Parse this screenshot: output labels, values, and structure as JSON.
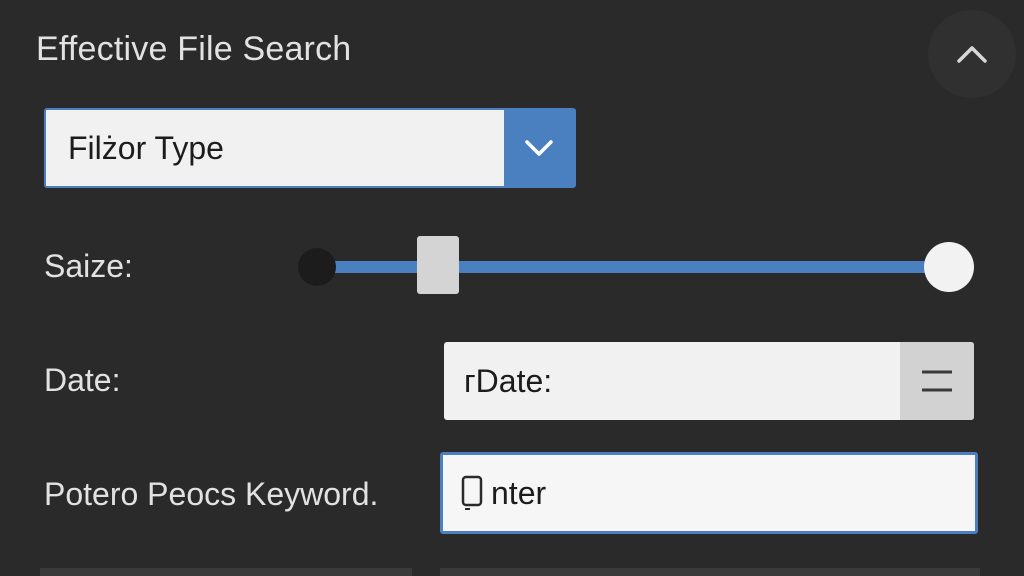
{
  "panel": {
    "title": "Effective File Search",
    "collapse_icon": "chevron-up-icon"
  },
  "filter": {
    "selected": "Filżor Type",
    "caret_icon": "chevron-down-icon"
  },
  "size": {
    "label": "Saize:",
    "slider_value_fraction": 0.19,
    "accent": "#4a7fc0"
  },
  "date": {
    "label": "Date:",
    "value": "ᴦDate:",
    "menu_icon": "menu-lines-icon"
  },
  "keyword": {
    "label": "Potero Peocs Keyword.",
    "value": "nter",
    "icon": "document-icon"
  }
}
